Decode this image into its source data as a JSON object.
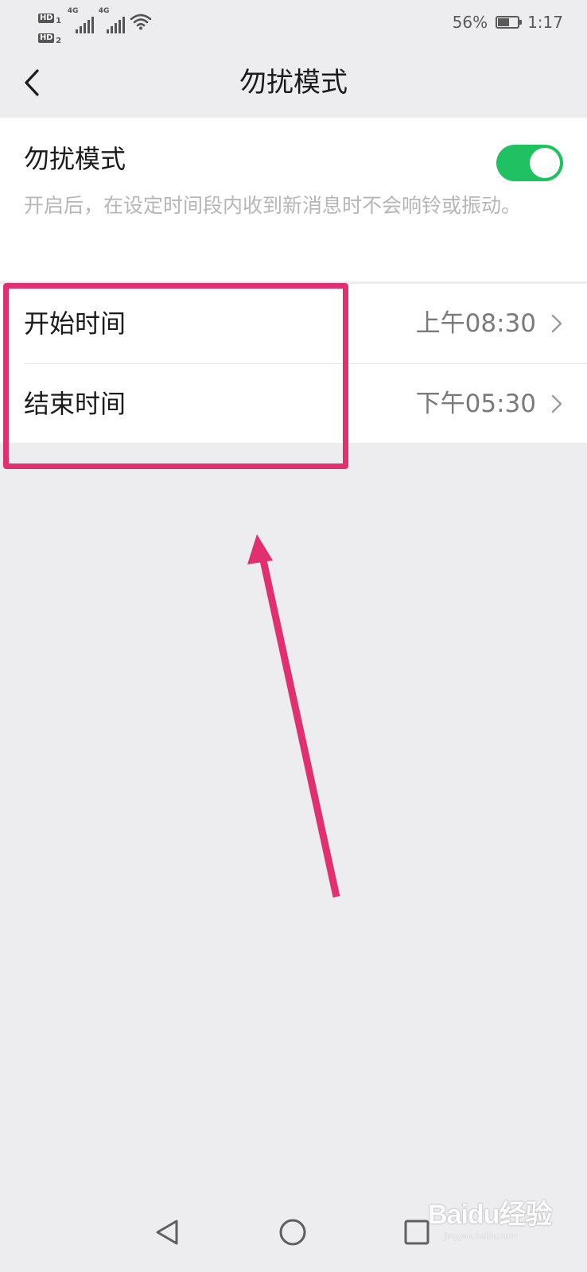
{
  "status_bar": {
    "hd1": "HD",
    "hd1_sub": "1",
    "hd2": "HD",
    "hd2_sub": "2",
    "network1": "4G",
    "network2": "4G",
    "battery_percent": "56%",
    "battery_level": 0.56,
    "time": "1:17"
  },
  "header": {
    "title": "勿扰模式"
  },
  "dnd": {
    "label": "勿扰模式",
    "description": "开启后，在设定时间段内收到新消息时不会响铃或振动。",
    "enabled": true,
    "toggle_color": "#1fc161"
  },
  "schedule": {
    "start_label": "开始时间",
    "start_value": "上午08:30",
    "end_label": "结束时间",
    "end_value": "下午05:30"
  },
  "annotation": {
    "color": "#e0306f"
  },
  "watermark": {
    "brand": "Baidu经验",
    "url": "jingyan.baidu.com"
  },
  "icons": {
    "back": "chevron-left-icon",
    "row_arrow": "chevron-right-icon",
    "nav_back": "triangle-back-icon",
    "nav_home": "circle-home-icon",
    "nav_recent": "square-recent-icon"
  }
}
